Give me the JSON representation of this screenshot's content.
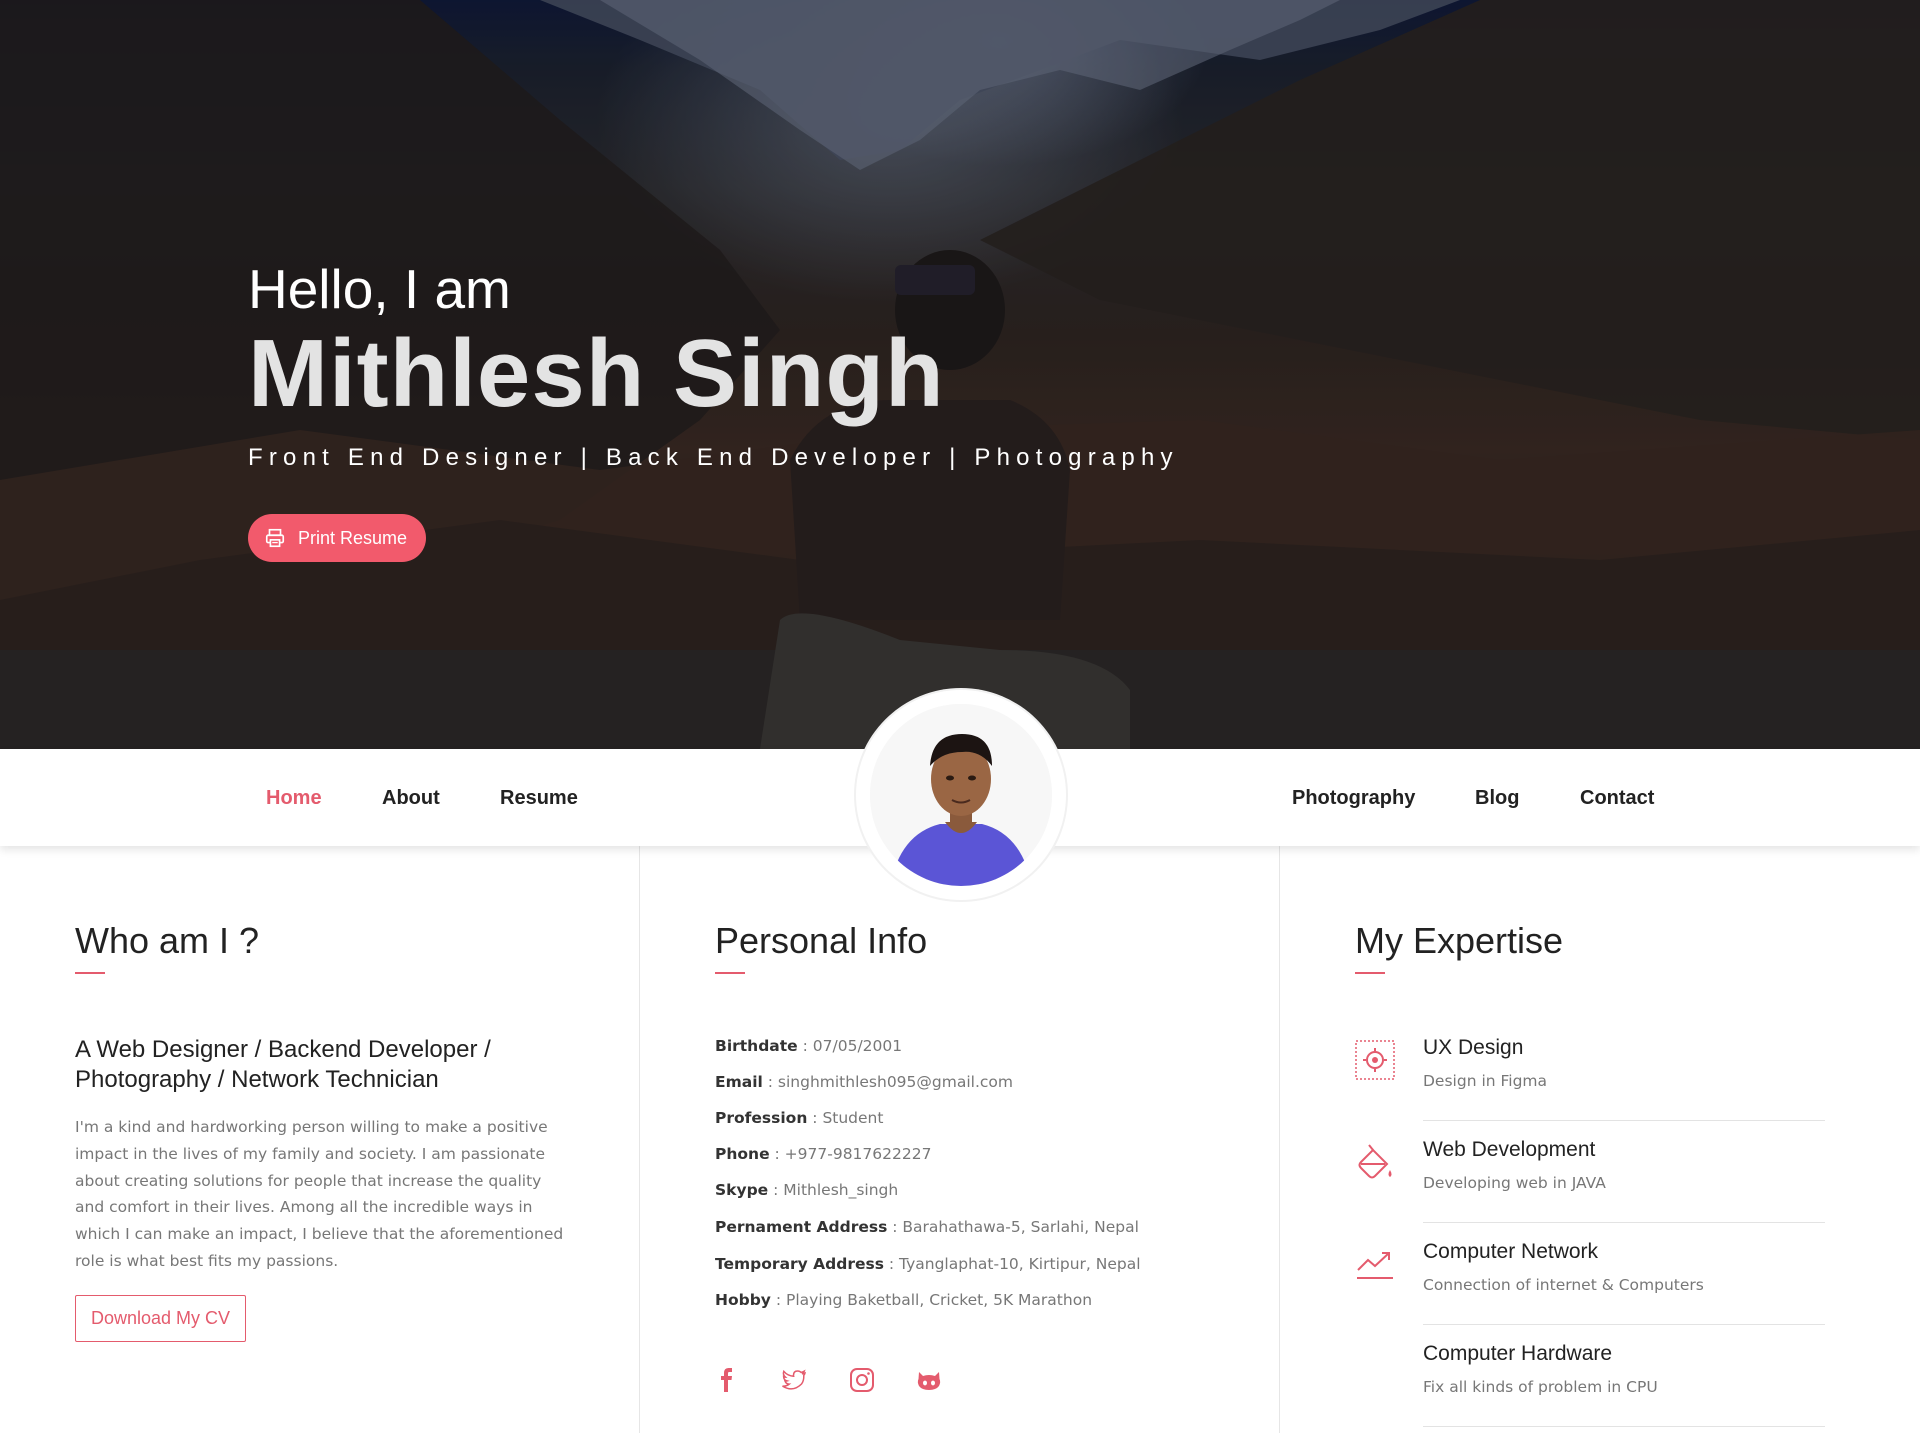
{
  "hero": {
    "greeting": "Hello, I am",
    "name": "Mithlesh Singh",
    "tagline": "Front End Designer | Back End Developer | Photography",
    "print_button": "Print Resume",
    "print_icon": "printer-icon"
  },
  "nav": {
    "left": [
      {
        "label": "Home",
        "active": true
      },
      {
        "label": "About",
        "active": false
      },
      {
        "label": "Resume",
        "active": false
      }
    ],
    "right": [
      {
        "label": "Photography",
        "active": false
      },
      {
        "label": "Blog",
        "active": false
      },
      {
        "label": "Contact",
        "active": false
      }
    ]
  },
  "who": {
    "title": "Who am I ?",
    "subtitle": "A Web Designer / Backend Developer / Photography / Network Technician",
    "text": "I'm a kind and hardworking person willing to make a positive impact in the lives of my family and society. I am passionate about creating solutions for people that increase the quality and comfort in their lives. Among all the incredible ways in which I can make an impact, I believe that the aforementioned role is what best fits my passions.",
    "cv_button": "Download My CV"
  },
  "info": {
    "title": "Personal Info",
    "rows": [
      {
        "label": "Birthdate",
        "value": "07/05/2001"
      },
      {
        "label": "Email",
        "value": "singhmithlesh095@gmail.com"
      },
      {
        "label": "Profession",
        "value": "Student"
      },
      {
        "label": "Phone",
        "value": "+977-9817622227"
      },
      {
        "label": "Skype",
        "value": "Mithlesh_singh"
      },
      {
        "label": "Pernament Address",
        "value": "Barahathawa-5, Sarlahi, Nepal"
      },
      {
        "label": "Temporary Address",
        "value": "Tyanglaphat-10, Kirtipur, Nepal"
      },
      {
        "label": "Hobby",
        "value": "Playing Baketball, Cricket, 5K Marathon"
      }
    ],
    "separator": " : ",
    "social": [
      "facebook-icon",
      "twitter-icon",
      "instagram-icon",
      "github-icon"
    ]
  },
  "expertise": {
    "title": "My Expertise",
    "items": [
      {
        "title": "UX Design",
        "desc": "Design in Figma",
        "icon": "design-icon"
      },
      {
        "title": "Web Development",
        "desc": "Developing web in JAVA",
        "icon": "paint-bucket-icon"
      },
      {
        "title": "Computer Network",
        "desc": "Connection of internet & Computers",
        "icon": "trending-chart-icon"
      },
      {
        "title": "Computer Hardware",
        "desc": "Fix all kinds of problem in CPU",
        "icon": ""
      }
    ]
  },
  "colors": {
    "accent": "#e45b6d",
    "button": "#f25a6c"
  }
}
